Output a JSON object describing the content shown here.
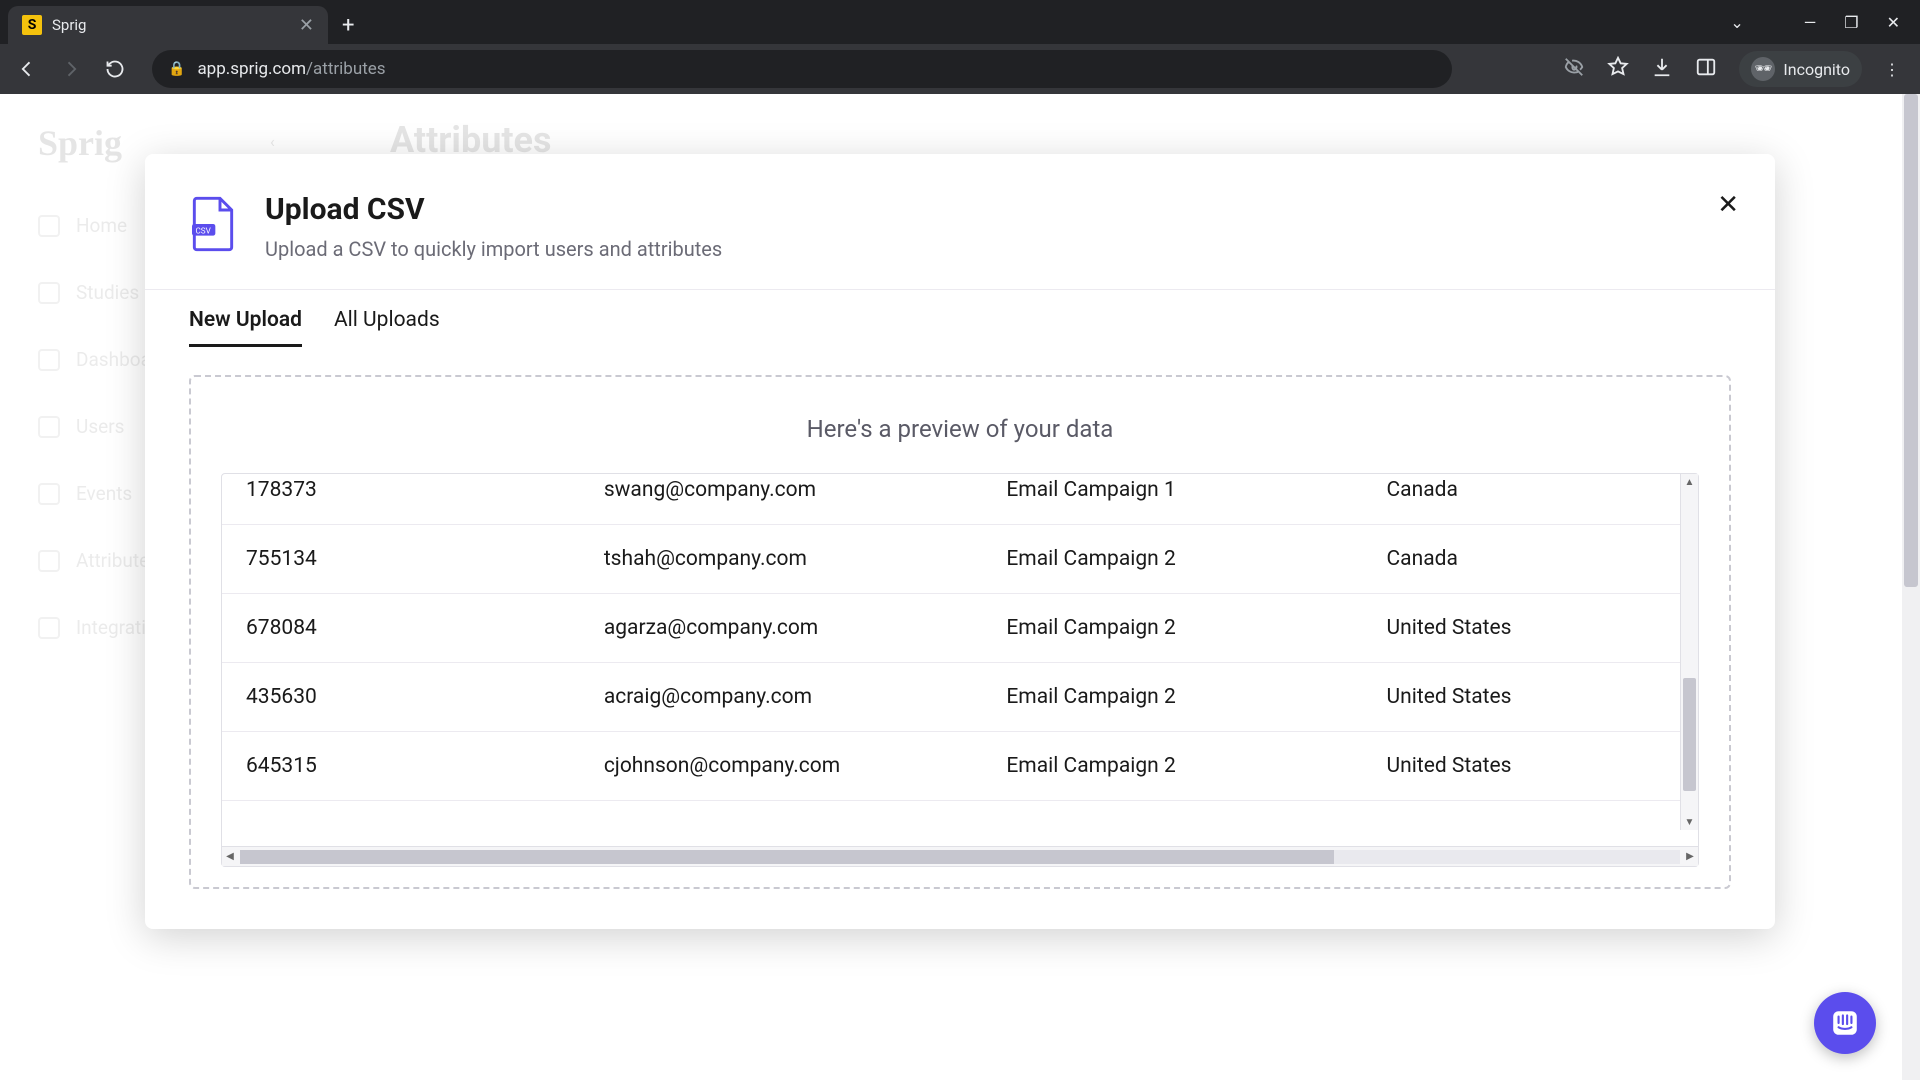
{
  "browser": {
    "tab_title": "Sprig",
    "favicon_letter": "S",
    "url_host": "app.sprig.com",
    "url_path": "/attributes",
    "incognito_label": "Incognito"
  },
  "background_app": {
    "logo": "Sprig",
    "page_title": "Attributes",
    "nav": [
      "Home",
      "Studies",
      "Dashboards",
      "Users",
      "Events",
      "Attributes",
      "Integrations"
    ]
  },
  "modal": {
    "title": "Upload CSV",
    "subtitle": "Upload a CSV to quickly import users and attributes",
    "tabs": {
      "new_upload": "New Upload",
      "all_uploads": "All Uploads"
    },
    "preview_heading": "Here's a preview of your data",
    "rows": [
      {
        "id": "178373",
        "email": "swang@company.com",
        "campaign": "Email Campaign 1",
        "country": "Canada"
      },
      {
        "id": "755134",
        "email": "tshah@company.com",
        "campaign": "Email Campaign 2",
        "country": "Canada"
      },
      {
        "id": "678084",
        "email": "agarza@company.com",
        "campaign": "Email Campaign 2",
        "country": "United States"
      },
      {
        "id": "435630",
        "email": "acraig@company.com",
        "campaign": "Email Campaign 2",
        "country": "United States"
      },
      {
        "id": "645315",
        "email": "cjohnson@company.com",
        "campaign": "Email Campaign 2",
        "country": "United States"
      }
    ]
  }
}
